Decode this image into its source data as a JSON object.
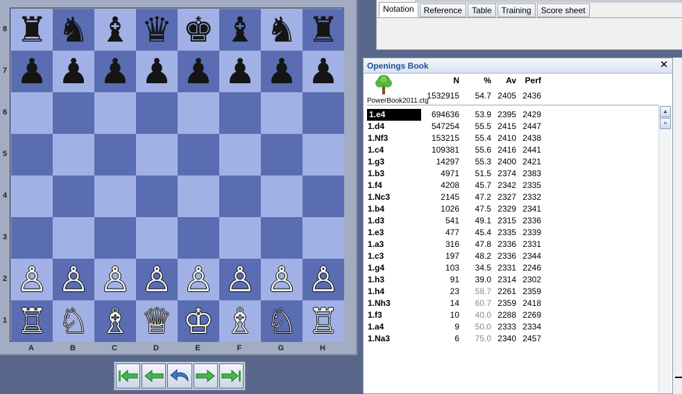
{
  "board": {
    "ranks": [
      "8",
      "7",
      "6",
      "5",
      "4",
      "3",
      "2",
      "1"
    ],
    "files": [
      "A",
      "B",
      "C",
      "D",
      "E",
      "F",
      "G",
      "H"
    ],
    "pieces": [
      [
        "♜",
        "♞",
        "♝",
        "♛",
        "♚",
        "♝",
        "♞",
        "♜"
      ],
      [
        "♟",
        "♟",
        "♟",
        "♟",
        "♟",
        "♟",
        "♟",
        "♟"
      ],
      [
        "",
        "",
        "",
        "",
        "",
        "",
        "",
        ""
      ],
      [
        "",
        "",
        "",
        "",
        "",
        "",
        "",
        ""
      ],
      [
        "",
        "",
        "",
        "",
        "",
        "",
        "",
        ""
      ],
      [
        "",
        "",
        "",
        "",
        "",
        "",
        "",
        ""
      ],
      [
        "♙",
        "♙",
        "♙",
        "♙",
        "♙",
        "♙",
        "♙",
        "♙"
      ],
      [
        "♖",
        "♘",
        "♗",
        "♕",
        "♔",
        "♗",
        "♘",
        "♖"
      ]
    ],
    "colors": {
      "light": "#a2b1e5",
      "dark": "#5a6db3"
    }
  },
  "nav": {
    "buttons": [
      "first-move",
      "prev-move",
      "take-back",
      "next-move",
      "last-move"
    ]
  },
  "tabs": [
    {
      "label": "Notation",
      "active": true
    },
    {
      "label": "Reference",
      "active": false
    },
    {
      "label": "Table",
      "active": false
    },
    {
      "label": "Training",
      "active": false
    },
    {
      "label": "Score sheet",
      "active": false
    }
  ],
  "book": {
    "title": "Openings Book",
    "close": "✕",
    "headers": {
      "n": "N",
      "pct": "%",
      "av": "Av",
      "perf": "Perf"
    },
    "summary": {
      "n": "1532915",
      "pct": "54.7",
      "av": "2405",
      "perf": "2436"
    },
    "file": "PowerBook2011.ctg",
    "rows": [
      {
        "move": "1.e4",
        "n": "694636",
        "pct": "53.9",
        "av": "2395",
        "perf": "2429",
        "sel": true
      },
      {
        "move": "1.d4",
        "n": "547254",
        "pct": "55.5",
        "av": "2415",
        "perf": "2447"
      },
      {
        "move": "1.Nf3",
        "n": "153215",
        "pct": "55.4",
        "av": "2410",
        "perf": "2438"
      },
      {
        "move": "1.c4",
        "n": "109381",
        "pct": "55.6",
        "av": "2416",
        "perf": "2441"
      },
      {
        "move": "1.g3",
        "n": "14297",
        "pct": "55.3",
        "av": "2400",
        "perf": "2421"
      },
      {
        "move": "1.b3",
        "n": "4971",
        "pct": "51.5",
        "av": "2374",
        "perf": "2383"
      },
      {
        "move": "1.f4",
        "n": "4208",
        "pct": "45.7",
        "av": "2342",
        "perf": "2335"
      },
      {
        "move": "1.Nc3",
        "n": "2145",
        "pct": "47.2",
        "av": "2327",
        "perf": "2332"
      },
      {
        "move": "1.b4",
        "n": "1026",
        "pct": "47.5",
        "av": "2329",
        "perf": "2341"
      },
      {
        "move": "1.d3",
        "n": "541",
        "pct": "49.1",
        "av": "2315",
        "perf": "2336"
      },
      {
        "move": "1.e3",
        "n": "477",
        "pct": "45.4",
        "av": "2335",
        "perf": "2339"
      },
      {
        "move": "1.a3",
        "n": "316",
        "pct": "47.8",
        "av": "2336",
        "perf": "2331"
      },
      {
        "move": "1.c3",
        "n": "197",
        "pct": "48.2",
        "av": "2336",
        "perf": "2344"
      },
      {
        "move": "1.g4",
        "n": "103",
        "pct": "34.5",
        "av": "2331",
        "perf": "2246"
      },
      {
        "move": "1.h3",
        "n": "91",
        "pct": "39.0",
        "av": "2314",
        "perf": "2302"
      },
      {
        "move": "1.h4",
        "n": "23",
        "pct": "58.7",
        "av": "2261",
        "perf": "2359",
        "gray": true
      },
      {
        "move": "1.Nh3",
        "n": "14",
        "pct": "60.7",
        "av": "2359",
        "perf": "2418",
        "gray": true
      },
      {
        "move": "1.f3",
        "n": "10",
        "pct": "40.0",
        "av": "2288",
        "perf": "2269",
        "gray": true
      },
      {
        "move": "1.a4",
        "n": "9",
        "pct": "50.0",
        "av": "2333",
        "perf": "2334",
        "gray": true
      },
      {
        "move": "1.Na3",
        "n": "6",
        "pct": "75.0",
        "av": "2340",
        "perf": "2457",
        "gray": true
      }
    ]
  }
}
